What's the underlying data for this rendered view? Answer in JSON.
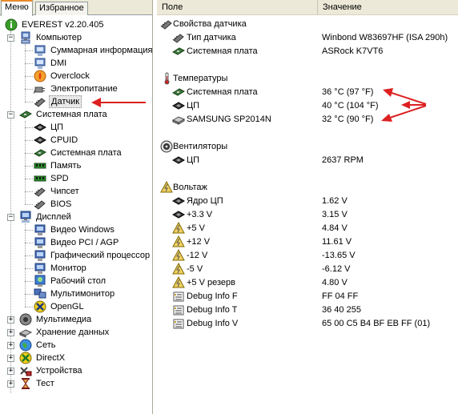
{
  "tabs": {
    "menu": "Меню",
    "favorites": "Избранное"
  },
  "tree": {
    "root": "EVEREST v2.20.405",
    "computer": {
      "label": "Компьютер",
      "items": [
        "Суммарная информация",
        "DMI",
        "Overclock",
        "Электропитание",
        "Датчик"
      ]
    },
    "motherboard": {
      "label": "Системная плата",
      "items": [
        "ЦП",
        "CPUID",
        "Системная плата",
        "Память",
        "SPD",
        "Чипсет",
        "BIOS"
      ]
    },
    "display": {
      "label": "Дисплей",
      "items": [
        "Видео Windows",
        "Видео PCI / AGP",
        "Графический процессор",
        "Монитор",
        "Рабочий стол",
        "Мультимонитор",
        "OpenGL"
      ]
    },
    "others": [
      "Мультимедиа",
      "Хранение данных",
      "Сеть",
      "DirectX",
      "Устройства",
      "Тест"
    ]
  },
  "columns": {
    "field": "Поле",
    "value": "Значение"
  },
  "sensor": {
    "props": {
      "title": "Свойства датчика",
      "rows": [
        {
          "field": "Тип датчика",
          "value": "Winbond W83697HF  (ISA 290h)"
        },
        {
          "field": "Системная плата",
          "value": "ASRock K7VT6"
        }
      ]
    },
    "temps": {
      "title": "Температуры",
      "rows": [
        {
          "field": "Системная плата",
          "value": "36 °C  (97 °F)"
        },
        {
          "field": "ЦП",
          "value": "40 °C  (104 °F)"
        },
        {
          "field": "SAMSUNG SP2014N",
          "value": "32 °C  (90 °F)"
        }
      ]
    },
    "fans": {
      "title": "Вентиляторы",
      "rows": [
        {
          "field": "ЦП",
          "value": "2637 RPM"
        }
      ]
    },
    "voltages": {
      "title": "Вольтаж",
      "rows": [
        {
          "field": "Ядро ЦП",
          "value": "1.62 V"
        },
        {
          "field": "+3.3 V",
          "value": "3.15 V"
        },
        {
          "field": "+5 V",
          "value": "4.84 V"
        },
        {
          "field": "+12 V",
          "value": "11.61 V"
        },
        {
          "field": "-12 V",
          "value": "-13.65 V"
        },
        {
          "field": "-5 V",
          "value": "-6.12 V"
        },
        {
          "field": "+5 V резерв",
          "value": "4.80 V"
        },
        {
          "field": "Debug Info F",
          "value": "FF 04 FF"
        },
        {
          "field": "Debug Info T",
          "value": "36 40 255"
        },
        {
          "field": "Debug Info V",
          "value": "65 00 C5 B4 BF EB FF (01)"
        }
      ]
    }
  },
  "colors": {
    "arrow": "#dd2020",
    "tab_accent": "#e68b2c",
    "header_bg": "#ece9d8"
  }
}
